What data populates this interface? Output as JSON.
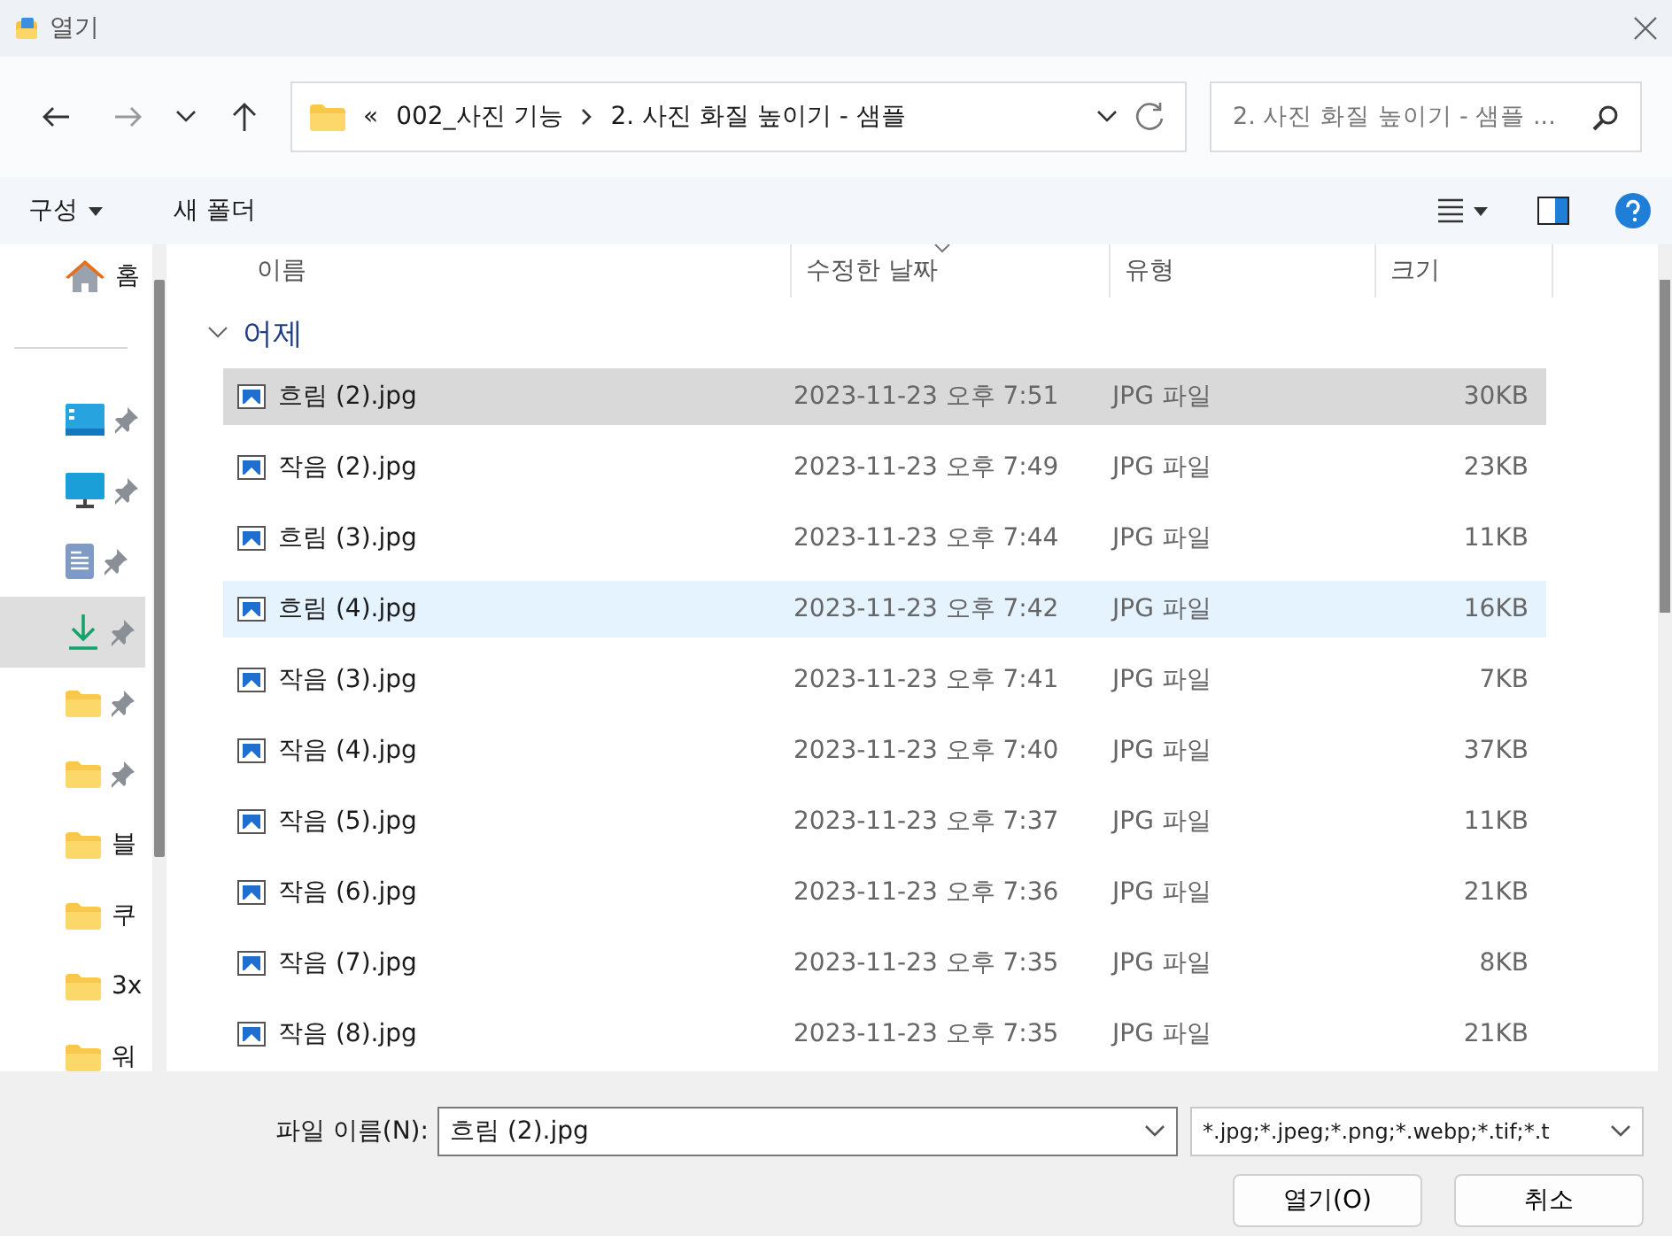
{
  "window": {
    "title": "열기"
  },
  "nav": {
    "overflow": "«",
    "path": [
      "002_사진 기능",
      "2. 사진 화질 높이기 - 샘플"
    ],
    "search_placeholder": "2. 사진 화질 높이기 - 샘플 ..."
  },
  "toolbar": {
    "organize": "구성",
    "new_folder": "새 폴더"
  },
  "sidebar": {
    "items": [
      {
        "kind": "home",
        "label": "홈",
        "selected": false
      },
      {
        "kind": "desktop",
        "pinned": true,
        "selected": false
      },
      {
        "kind": "monitor",
        "pinned": true,
        "selected": false
      },
      {
        "kind": "document",
        "pinned": true,
        "selected": false
      },
      {
        "kind": "download",
        "pinned": true,
        "selected": true
      },
      {
        "kind": "folder",
        "pinned": true,
        "selected": false
      },
      {
        "kind": "folder",
        "pinned": true,
        "selected": false
      },
      {
        "kind": "folder",
        "label": "블",
        "selected": false
      },
      {
        "kind": "folder",
        "label": "쿠",
        "selected": false
      },
      {
        "kind": "folder",
        "label": "3x",
        "selected": false
      },
      {
        "kind": "folder",
        "label": "워",
        "selected": false
      }
    ]
  },
  "columns": [
    {
      "label": "이름",
      "sorted": false
    },
    {
      "label": "수정한 날짜",
      "sorted": true
    },
    {
      "label": "유형",
      "sorted": false
    },
    {
      "label": "크기",
      "sorted": false
    }
  ],
  "group": {
    "label": "어제",
    "expanded": true,
    "rows": [
      {
        "name": "흐림 (2).jpg",
        "date": "2023-11-23 오후 7:51",
        "type": "JPG 파일",
        "size": "30KB",
        "selected": true,
        "hovered": false
      },
      {
        "name": "작음 (2).jpg",
        "date": "2023-11-23 오후 7:49",
        "type": "JPG 파일",
        "size": "23KB",
        "selected": false,
        "hovered": false
      },
      {
        "name": "흐림 (3).jpg",
        "date": "2023-11-23 오후 7:44",
        "type": "JPG 파일",
        "size": "11KB",
        "selected": false,
        "hovered": false
      },
      {
        "name": "흐림 (4).jpg",
        "date": "2023-11-23 오후 7:42",
        "type": "JPG 파일",
        "size": "16KB",
        "selected": false,
        "hovered": true
      },
      {
        "name": "작음 (3).jpg",
        "date": "2023-11-23 오후 7:41",
        "type": "JPG 파일",
        "size": "7KB",
        "selected": false,
        "hovered": false
      },
      {
        "name": "작음 (4).jpg",
        "date": "2023-11-23 오후 7:40",
        "type": "JPG 파일",
        "size": "37KB",
        "selected": false,
        "hovered": false
      },
      {
        "name": "작음 (5).jpg",
        "date": "2023-11-23 오후 7:37",
        "type": "JPG 파일",
        "size": "11KB",
        "selected": false,
        "hovered": false
      },
      {
        "name": "작음 (6).jpg",
        "date": "2023-11-23 오후 7:36",
        "type": "JPG 파일",
        "size": "21KB",
        "selected": false,
        "hovered": false
      },
      {
        "name": "작음 (7).jpg",
        "date": "2023-11-23 오후 7:35",
        "type": "JPG 파일",
        "size": "8KB",
        "selected": false,
        "hovered": false
      },
      {
        "name": "작음 (8).jpg",
        "date": "2023-11-23 오후 7:35",
        "type": "JPG 파일",
        "size": "21KB",
        "selected": false,
        "hovered": false
      }
    ]
  },
  "footer": {
    "filename_label": "파일 이름(N):",
    "filename": "흐림 (2).jpg",
    "filter": "*.jpg;*.jpeg;*.png;*.webp;*.tif;*.t",
    "buttons": [
      "열기(O)",
      "취소"
    ]
  }
}
